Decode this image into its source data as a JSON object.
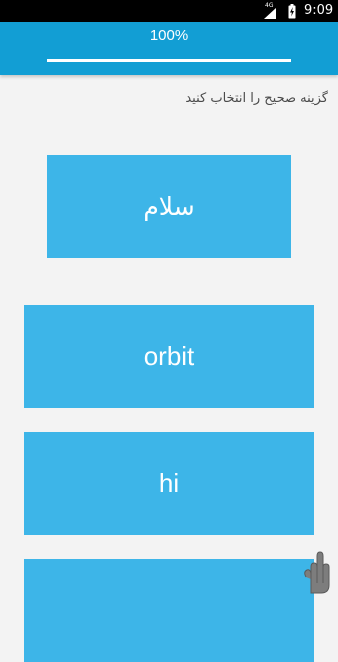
{
  "status_bar": {
    "network_type": "4G",
    "time": "9:09",
    "icons": [
      "signal-icon",
      "battery-charging-icon"
    ]
  },
  "progress": {
    "label": "100%",
    "value": 1.0
  },
  "quiz": {
    "instruction": "گزینه صحیح را انتخاب کنید",
    "prompt_word": "سلام",
    "options": [
      "orbit",
      "hi",
      ""
    ]
  },
  "colors": {
    "status_bar": "#000000",
    "header": "#129ed4",
    "card": "#3db5e8",
    "background": "#f3f3f3",
    "instruction_text": "#4a4a4a"
  },
  "side_handle_icon": "hand-swipe-icon"
}
